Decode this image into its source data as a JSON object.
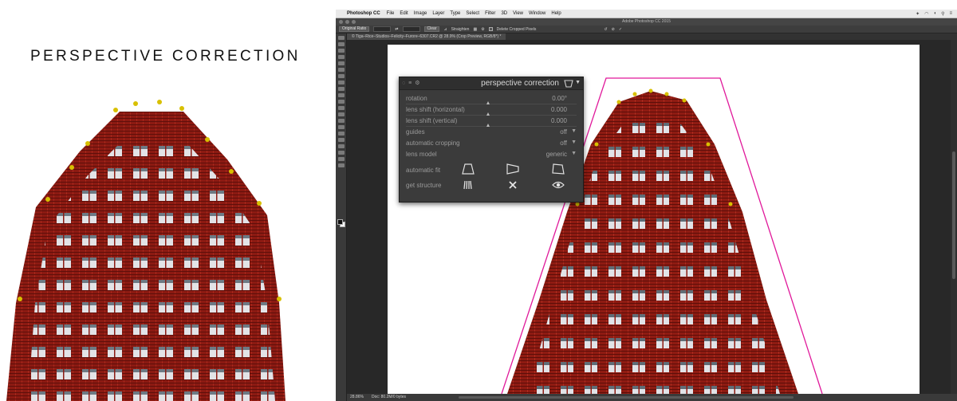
{
  "left": {
    "title": "PERSPECTIVE CORRECTION"
  },
  "menubar": {
    "app_name": "Photoshop CC",
    "menus": [
      "File",
      "Edit",
      "Image",
      "Layer",
      "Type",
      "Select",
      "Filter",
      "3D",
      "View",
      "Window",
      "Help"
    ]
  },
  "window": {
    "title": "Adobe Photoshop CC 2015"
  },
  "options_bar": {
    "ratio": "Original Ratio",
    "clear": "Clear",
    "straighten": "Straighten",
    "delete_cropped": "Delete Cropped Pixels"
  },
  "document": {
    "tab_label": "© Tiga–Rice–Studios–Felicity–Furore–6307.CR2 @ 28.9% (Crop Preview, RGB/8*) *"
  },
  "status": {
    "zoom": "28.86%",
    "doc_size": "Doc: 80.2M/0 bytes"
  },
  "panel": {
    "title": "perspective correction",
    "rows": [
      {
        "label": "rotation",
        "value": "0.00°"
      },
      {
        "label": "lens shift (horizontal)",
        "value": "0.000"
      },
      {
        "label": "lens shift (vertical)",
        "value": "0.000"
      },
      {
        "label": "guides",
        "value": "off"
      },
      {
        "label": "automatic cropping",
        "value": "off"
      },
      {
        "label": "lens model",
        "value": "generic"
      }
    ],
    "automatic_fit_label": "automatic fit",
    "get_structure_label": "get structure"
  },
  "colors": {
    "brick": "#8f1b12",
    "guide_line": "#e0189a",
    "ps_dark": "#2c2c2c",
    "panel_bg": "#3b3b3b"
  }
}
